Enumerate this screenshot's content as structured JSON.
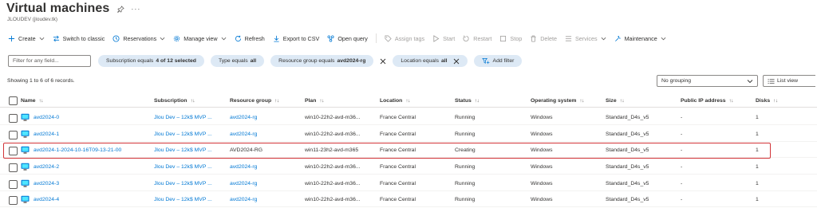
{
  "header": {
    "title": "Virtual machines",
    "subtitle": "JLOUDEV (jloudev.tk)",
    "more": "···"
  },
  "toolbar": {
    "create": "Create",
    "switch_classic": "Switch to classic",
    "reservations": "Reservations",
    "manage_view": "Manage view",
    "refresh": "Refresh",
    "export_csv": "Export to CSV",
    "open_query": "Open query",
    "assign_tags": "Assign tags",
    "start": "Start",
    "restart": "Restart",
    "stop": "Stop",
    "delete": "Delete",
    "services": "Services",
    "maintenance": "Maintenance"
  },
  "filters": {
    "search_placeholder": "Filter for any field...",
    "subscription": {
      "prefix": "Subscription equals",
      "value": "4 of 12 selected"
    },
    "type": {
      "prefix": "Type equals",
      "value": "all"
    },
    "resource_group": {
      "prefix": "Resource group equals",
      "value": "avd2024-rg"
    },
    "location": {
      "prefix": "Location equals",
      "value": "all"
    },
    "add_filter": "Add filter"
  },
  "records_text": "Showing 1 to 6 of 6 records.",
  "grouping": "No grouping",
  "view_mode": "List view",
  "columns": {
    "name": "Name",
    "subscription": "Subscription",
    "resource_group": "Resource group",
    "plan": "Plan",
    "location": "Location",
    "status": "Status",
    "os": "Operating system",
    "size": "Size",
    "public_ip": "Public IP address",
    "disks": "Disks"
  },
  "sort_glyph": "↑↓",
  "name_sort_glyph": "↑↓",
  "rows": [
    {
      "name": "avd2024-0",
      "subscription": "Jlou Dev – 12k$ MVP ...",
      "resource_group": "avd2024-rg",
      "plan": "win10-22h2-avd-m36...",
      "location": "France Central",
      "status": "Running",
      "os": "Windows",
      "size": "Standard_D4s_v5",
      "public_ip": "-",
      "disks": "1"
    },
    {
      "name": "avd2024-1",
      "subscription": "Jlou Dev – 12k$ MVP ...",
      "resource_group": "avd2024-rg",
      "plan": "win10-22h2-avd-m36...",
      "location": "France Central",
      "status": "Running",
      "os": "Windows",
      "size": "Standard_D4s_v5",
      "public_ip": "-",
      "disks": "1"
    },
    {
      "name": "avd2024-1-2024-10-16T09-13-21-00",
      "subscription": "Jlou Dev – 12k$ MVP ...",
      "resource_group": "AVD2024-RG",
      "plan": "win11-23h2-avd-m365",
      "location": "France Central",
      "status": "Creating",
      "os": "Windows",
      "size": "Standard_D4s_v5",
      "public_ip": "-",
      "disks": "1"
    },
    {
      "name": "avd2024-2",
      "subscription": "Jlou Dev – 12k$ MVP ...",
      "resource_group": "avd2024-rg",
      "plan": "win10-22h2-avd-m36...",
      "location": "France Central",
      "status": "Running",
      "os": "Windows",
      "size": "Standard_D4s_v5",
      "public_ip": "-",
      "disks": "1"
    },
    {
      "name": "avd2024-3",
      "subscription": "Jlou Dev – 12k$ MVP ...",
      "resource_group": "avd2024-rg",
      "plan": "win10-22h2-avd-m36...",
      "location": "France Central",
      "status": "Running",
      "os": "Windows",
      "size": "Standard_D4s_v5",
      "public_ip": "-",
      "disks": "1"
    },
    {
      "name": "avd2024-4",
      "subscription": "Jlou Dev – 12k$ MVP ...",
      "resource_group": "avd2024-rg",
      "plan": "win10-22h2-avd-m36...",
      "location": "France Central",
      "status": "Running",
      "os": "Windows",
      "size": "Standard_D4s_v5",
      "public_ip": "-",
      "disks": "1"
    }
  ],
  "highlighted_row": 2,
  "colors": {
    "accent": "#0078d4",
    "highlight": "#d13438",
    "pill_bg": "#dde9f5",
    "text": "#323130"
  },
  "icons": [
    "pin-icon",
    "plus-icon",
    "switch-icon",
    "reservations-icon",
    "gear-icon",
    "refresh-icon",
    "download-icon",
    "query-icon",
    "tag-icon",
    "play-icon",
    "restart-icon",
    "stop-icon",
    "delete-icon",
    "services-icon",
    "wrench-icon",
    "close-icon",
    "add-filter-icon",
    "list-view-icon",
    "chevron-down-icon",
    "vm-icon"
  ]
}
